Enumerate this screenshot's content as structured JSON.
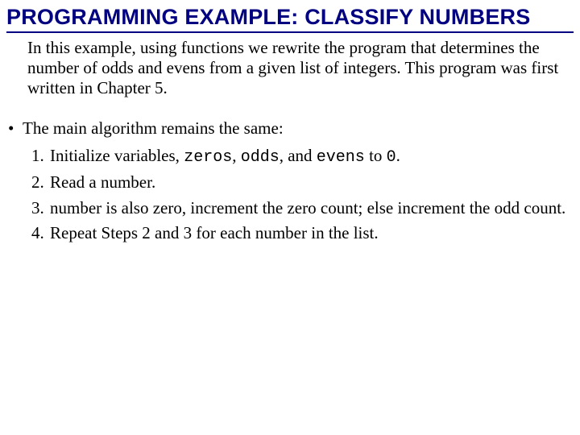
{
  "title": "PROGRAMMING EXAMPLE: CLASSIFY NUMBERS",
  "intro": "In this example, using functions we rewrite the program that determines the number of odds and evens from a given list of integers. This program was first written in Chapter 5.",
  "bullet_dot": "•",
  "bullet_text": "The main algorithm remains the same:",
  "steps": {
    "s1_a": "Initialize variables, ",
    "s1_v1": "zeros",
    "s1_b": ", ",
    "s1_v2": "odds",
    "s1_c": ", and ",
    "s1_v3": "evens",
    "s1_d": " to ",
    "s1_v4": "0",
    "s1_e": ".",
    "s2": "Read a number.",
    "s3": "number is also zero, increment the zero count; else increment the odd count.",
    "s4": "Repeat Steps 2 and 3 for each number in the list."
  }
}
